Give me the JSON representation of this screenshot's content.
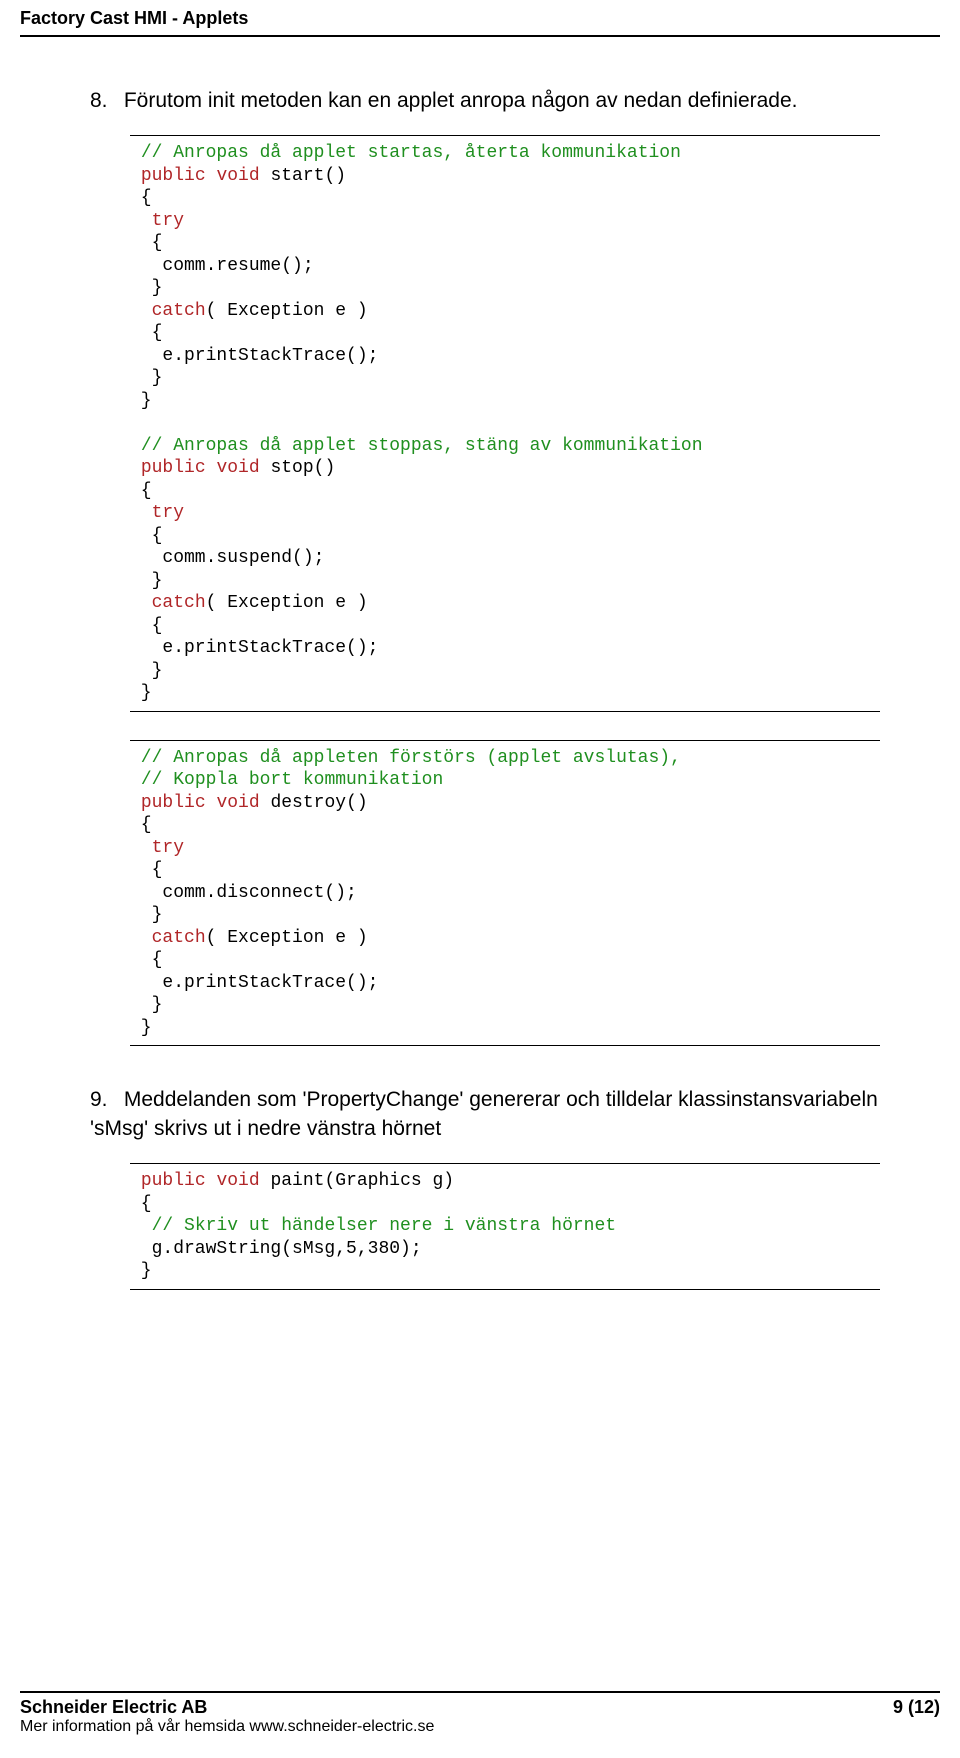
{
  "header": {
    "title": "Factory Cast HMI - Applets"
  },
  "section8": {
    "number": "8.",
    "text": "Förutom init metoden kan en applet anropa någon av nedan definierade.",
    "code1": {
      "c1": "// Anropas då applet startas, återta kommunikation",
      "k1": "public",
      "k2": "void",
      "p1": " start()",
      "p2": " {",
      "k3": "try",
      "p3": "  {",
      "p4": "   comm.resume();",
      "p5": "  }",
      "k4": "catch",
      "p6": "( Exception e )",
      "p7": "  {",
      "p8": "   e.printStackTrace();",
      "p9": "  }",
      "p10": " }",
      "c2": "// Anropas då applet stoppas, stäng av kommunikation",
      "k5": "public",
      "k6": "void",
      "p11": " stop()",
      "p12": " {",
      "k7": "try",
      "p13": "  {",
      "p14": "   comm.suspend();",
      "p15": "  }",
      "k8": "catch",
      "p16": "( Exception e )",
      "p17": "  {",
      "p18": "   e.printStackTrace();",
      "p19": "  }",
      "p20": " }"
    },
    "code2": {
      "c1": " // Anropas då appleten förstörs (applet avslutas),",
      "c2": "// Koppla bort kommunikation",
      "k1": "public",
      "k2": "void",
      "p1": " destroy()",
      "p2": " {",
      "k3": "try",
      "p3": "  {",
      "p4": "   comm.disconnect();",
      "p5": "  }",
      "k4": "catch",
      "p6": "( Exception e )",
      "p7": "  {",
      "p8": "   e.printStackTrace();",
      "p9": "  }",
      "p10": " }"
    }
  },
  "section9": {
    "number": "9.",
    "text": "Meddelanden som 'PropertyChange' genererar och tilldelar klassinstansvariabeln 'sMsg' skrivs ut i nedre vänstra hörnet",
    "code": {
      "k1": "public",
      "k2": "void",
      "p1": " paint(Graphics g)",
      "p2": " {",
      "c1": "// Skriv ut händelser nere i vänstra hörnet",
      "p3": "  g.drawString(sMsg,5,380);",
      "p4": " }"
    }
  },
  "footer": {
    "company": "Schneider Electric AB",
    "sub": "Mer information på vår hemsida www.schneider-electric.se",
    "page": "9 (12)"
  }
}
